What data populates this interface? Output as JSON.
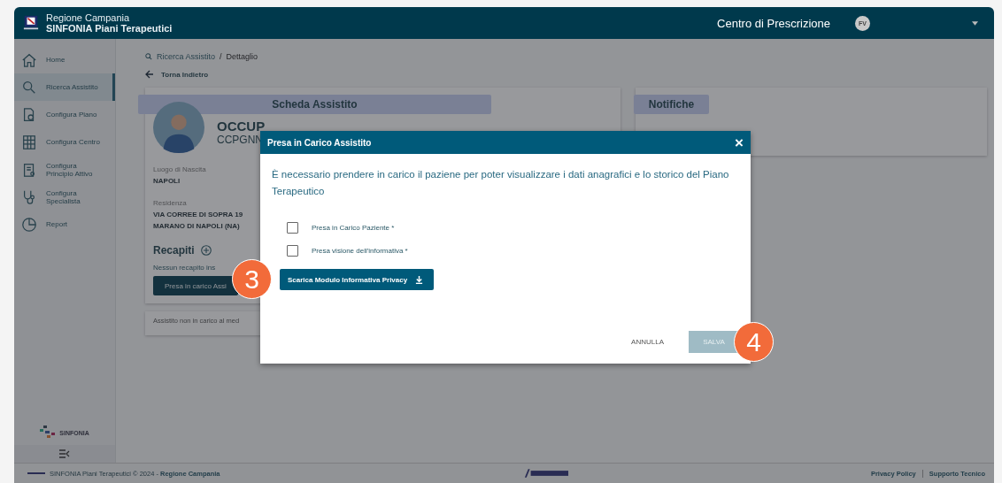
{
  "header": {
    "region": "Regione Campania",
    "app_name": "SINFONIA Piani Terapeutici",
    "context": "Centro di Prescrizione",
    "user_initials": "FV"
  },
  "sidebar": {
    "items": [
      {
        "label": "Home",
        "selected": false
      },
      {
        "label": "Ricerca Assistito",
        "selected": true
      },
      {
        "label": "Configura Piano",
        "selected": false
      },
      {
        "label": "Configura Centro",
        "selected": false
      },
      {
        "label": "Configura Principio Attivo",
        "selected": false
      },
      {
        "label": "Configura Specialista",
        "selected": false
      },
      {
        "label": "Report",
        "selected": false
      }
    ],
    "brand": "SINFONIA"
  },
  "breadcrumb": {
    "items": [
      "Ricerca Assistito",
      "Dettaglio"
    ],
    "separator": "/"
  },
  "back_link": "Torna Indietro",
  "patient_card": {
    "title": "Scheda Assistito",
    "name": "OCCUP",
    "code": "CCPGNN",
    "fields": [
      {
        "label": "Luogo di Nascita",
        "lines": [
          "NAPOLI"
        ]
      },
      {
        "label": "Residenza",
        "lines": [
          "VIA CORREE DI SOPRA 19",
          "MARANO DI NAPOLI (NA)"
        ]
      }
    ],
    "contacts_title": "Recapiti",
    "contacts_empty": "Nessun recapito ins",
    "action_button": "Presa in carico Assi"
  },
  "status_card": {
    "text": "Assistito non in carico al med"
  },
  "notifications_card": {
    "title": "Notifiche"
  },
  "modal": {
    "title": "Presa in Carico Assistito",
    "close": "×",
    "message": "È necessario prendere in carico il paziene per poter visualizzare i dati anagrafici e lo storico del Piano Terapeutico",
    "checkboxes": [
      {
        "label": "Presa in Carico Paziente *",
        "checked": false
      },
      {
        "label": "Presa visione dell'informativa *",
        "checked": false
      }
    ],
    "download_button": "Scarica Modulo Informativa Privacy",
    "download_callout": "3",
    "cancel_button": "ANNULLA",
    "save_button": {
      "label": "SALVA",
      "disabled": true,
      "callout": "4"
    }
  },
  "footer": {
    "copyright": "SINFONIA Piani Terapeutici © 2024 - ",
    "copyright_link": "Regione Campania",
    "links": [
      "Privacy Policy",
      "Supporto Tecnico"
    ]
  }
}
